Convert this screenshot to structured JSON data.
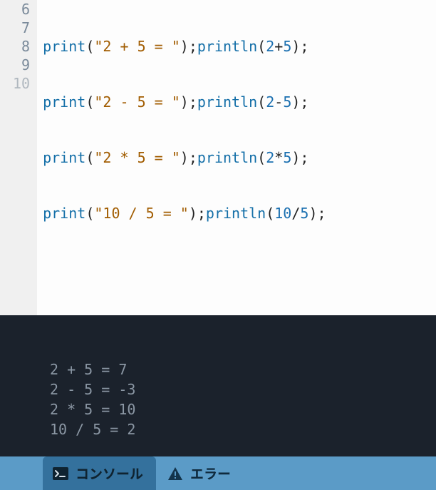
{
  "editor": {
    "first_line_number": 6,
    "lines": [
      {
        "n": 6,
        "fn1": "print",
        "str": "\"2 + 5 = \"",
        "fn2": "println",
        "a": 2,
        "op": "+",
        "b": 5
      },
      {
        "n": 7,
        "fn1": "print",
        "str": "\"2 - 5 = \"",
        "fn2": "println",
        "a": 2,
        "op": "-",
        "b": 5
      },
      {
        "n": 8,
        "fn1": "print",
        "str": "\"2 * 5 = \"",
        "fn2": "println",
        "a": 2,
        "op": "*",
        "b": 5
      },
      {
        "n": 9,
        "fn1": "print",
        "str": "\"10 / 5 = \"",
        "fn2": "println",
        "a": 10,
        "op": "/",
        "b": 5
      }
    ],
    "trailing_empty_line_number": 10
  },
  "console_output": "2 + 5 = 7\n2 - 5 = -3\n2 * 5 = 10\n10 / 5 = 2",
  "tabs": {
    "console": {
      "label": "コンソール",
      "active": true
    },
    "errors": {
      "label": "エラー",
      "active": false
    }
  }
}
